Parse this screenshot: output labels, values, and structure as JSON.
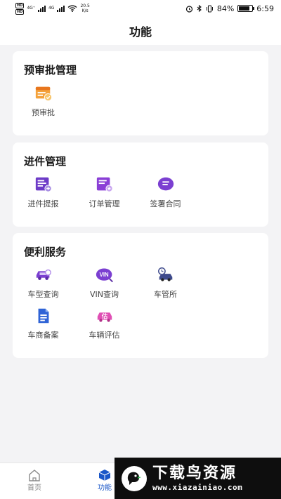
{
  "status": {
    "net_left": "4G⁺",
    "net_right": "4G",
    "speed_value": "20.5",
    "speed_unit": "K/s",
    "battery": "84%",
    "battery_level": 0.84,
    "time": "6:59"
  },
  "header": {
    "title": "功能"
  },
  "sections": [
    {
      "title": "预审批管理",
      "items": [
        {
          "label": "预审批",
          "icon": "pre-approval-icon"
        }
      ]
    },
    {
      "title": "进件管理",
      "items": [
        {
          "label": "进件提报",
          "icon": "submit-application-icon"
        },
        {
          "label": "订单管理",
          "icon": "order-management-icon"
        },
        {
          "label": "签署合同",
          "icon": "sign-contract-icon"
        }
      ]
    },
    {
      "title": "便利服务",
      "items": [
        {
          "label": "车型查询",
          "icon": "car-model-query-icon"
        },
        {
          "label": "VIN查询",
          "icon": "vin-query-icon"
        },
        {
          "label": "车管所",
          "icon": "vehicle-admin-office-icon"
        },
        {
          "label": "车商备案",
          "icon": "dealer-filing-icon"
        },
        {
          "label": "车辆评估",
          "icon": "vehicle-evaluation-icon"
        }
      ]
    }
  ],
  "tabbar": {
    "home": "首页",
    "function": "功能"
  },
  "watermark": {
    "title": "下载鸟资源",
    "url": "www.xiazainiao.com"
  },
  "colors": {
    "accent": "#1a56c8",
    "purple": "#7b3fd1",
    "orange": "#f08a2e"
  }
}
